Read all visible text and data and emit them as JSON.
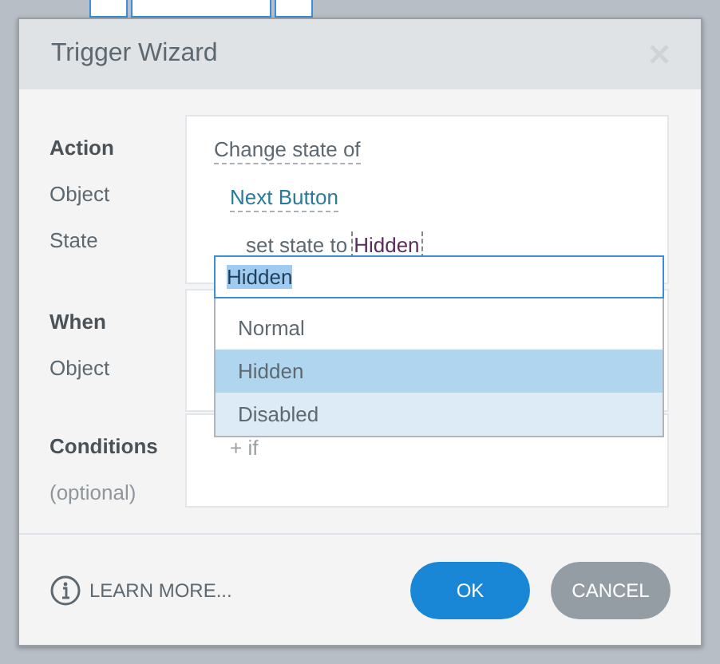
{
  "dialog": {
    "title": "Trigger Wizard"
  },
  "sections": [
    {
      "labels": [
        {
          "text": "Action",
          "kind": "heading"
        },
        {
          "text": "Object",
          "kind": "label"
        },
        {
          "text": "State",
          "kind": "label"
        }
      ],
      "content": [
        {
          "kind": "menu-link",
          "text": "Change state of"
        },
        {
          "kind": "object-link",
          "text": "Next Button"
        },
        {
          "kind": "assignment",
          "prefix": "set state to",
          "value": "Hidden"
        }
      ]
    },
    {
      "labels": [
        {
          "text": "When",
          "kind": "heading"
        },
        {
          "text": "Object",
          "kind": "label"
        }
      ]
    },
    {
      "labels": [
        {
          "text": "Conditions",
          "kind": "heading"
        },
        {
          "text": "(optional)",
          "kind": "note"
        }
      ],
      "content": [
        {
          "kind": "add",
          "text": "+ if"
        }
      ]
    }
  ],
  "dropdown": {
    "value": "Hidden",
    "value_selected": true,
    "options": [
      {
        "label": "Normal",
        "selected": false,
        "hovered": false
      },
      {
        "label": "Hidden",
        "selected": true,
        "hovered": false
      },
      {
        "label": "Disabled",
        "selected": false,
        "hovered": true
      }
    ]
  },
  "footer": {
    "learn_more": "LEARN MORE...",
    "buttons": [
      {
        "label": "OK",
        "kind": "primary"
      },
      {
        "label": "CANCEL",
        "kind": "secondary"
      }
    ]
  }
}
